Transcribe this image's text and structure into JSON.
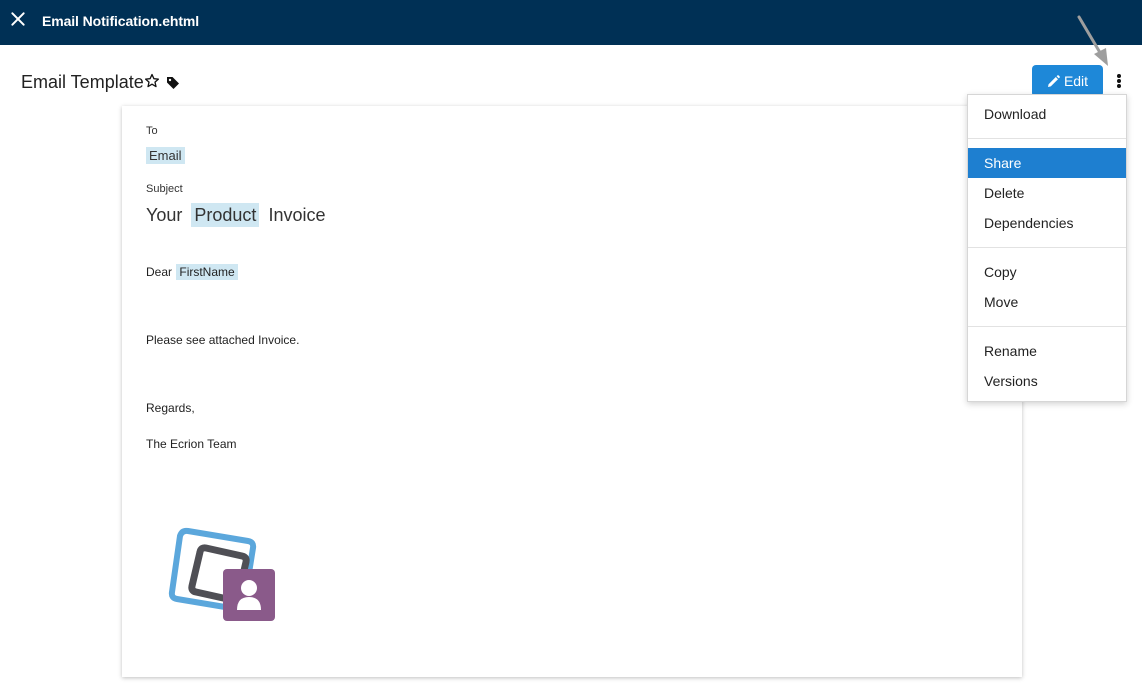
{
  "window": {
    "title": "Email Notification.ehtml"
  },
  "header": {
    "page_title": "Email Template",
    "edit_label": "Edit"
  },
  "colors": {
    "topbar": "#003055",
    "accent": "#1e88d8",
    "menu_active": "#1e7fd0",
    "field_highlight": "#cfe7f2",
    "logo_badge": "#8a5a8a"
  },
  "email": {
    "to_label": "To",
    "to_value": "Email",
    "subject_label": "Subject",
    "subject_before": "Your",
    "subject_field": "Product",
    "subject_after": "Invoice",
    "greeting": "Dear",
    "greeting_field": "FirstName",
    "line1": "Please see attached Invoice.",
    "closing": "Regards,",
    "signature": "The Ecrion Team"
  },
  "menu": {
    "download": "Download",
    "share": "Share",
    "delete": "Delete",
    "dependencies": "Dependencies",
    "copy": "Copy",
    "move": "Move",
    "rename": "Rename",
    "versions": "Versions",
    "active_item": "Share"
  },
  "icons": [
    "close-icon",
    "star-icon",
    "tag-icon",
    "pencil-icon",
    "more-vertical-icon",
    "logo-icon",
    "pointer-arrow-icon"
  ]
}
